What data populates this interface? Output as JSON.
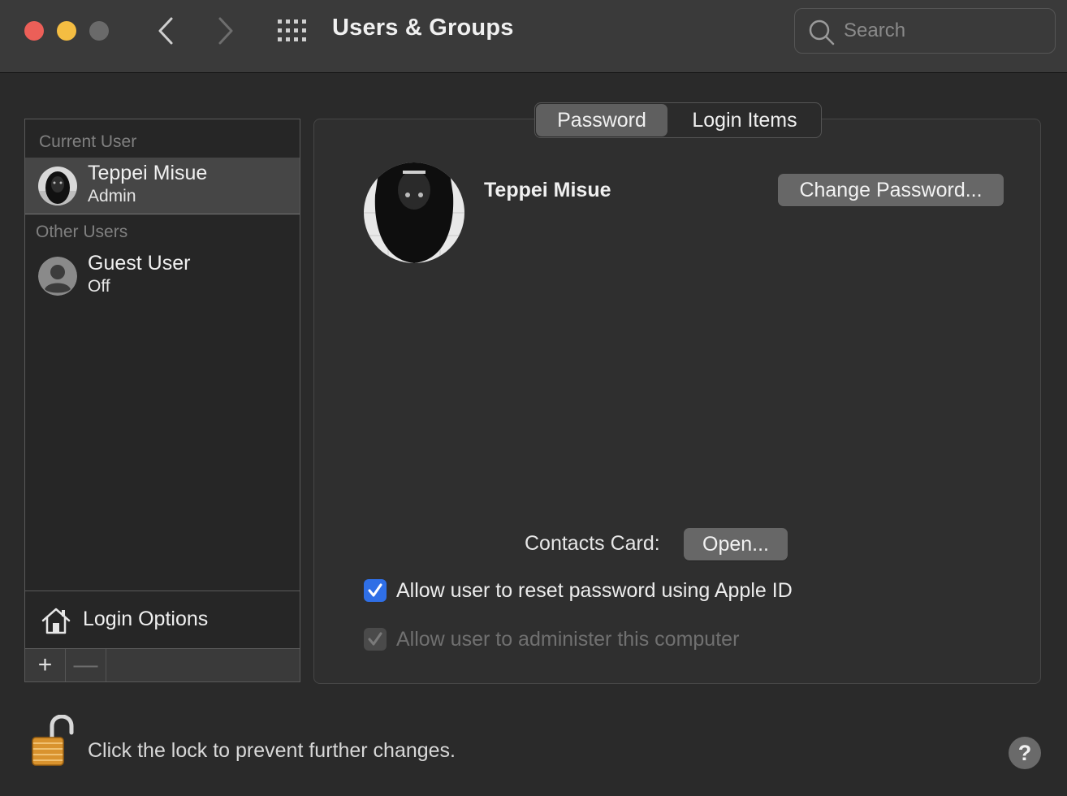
{
  "window": {
    "title": "Users & Groups",
    "search_placeholder": "Search"
  },
  "sidebar": {
    "current_header": "Current User",
    "current_user": {
      "name": "Teppei Misue",
      "role": "Admin"
    },
    "other_header": "Other Users",
    "other_users": [
      {
        "name": "Guest User",
        "status": "Off"
      }
    ],
    "login_options_label": "Login Options",
    "add_label": "+",
    "remove_label": "—"
  },
  "tabs": [
    {
      "label": "Password",
      "selected": true
    },
    {
      "label": "Login Items",
      "selected": false
    }
  ],
  "profile": {
    "name": "Teppei Misue",
    "change_password_label": "Change Password...",
    "contacts_card_label": "Contacts Card:",
    "open_label": "Open...",
    "options": [
      {
        "label": "Allow user to reset password using Apple ID",
        "checked": true,
        "enabled": true
      },
      {
        "label": "Allow user to administer this computer",
        "checked": true,
        "enabled": false
      }
    ]
  },
  "footer": {
    "lock_text": "Click the lock to prevent further changes.",
    "help_label": "?"
  },
  "colors": {
    "close": "#ec5f58",
    "minimize": "#f4bd42",
    "accent": "#2f6fe6"
  }
}
